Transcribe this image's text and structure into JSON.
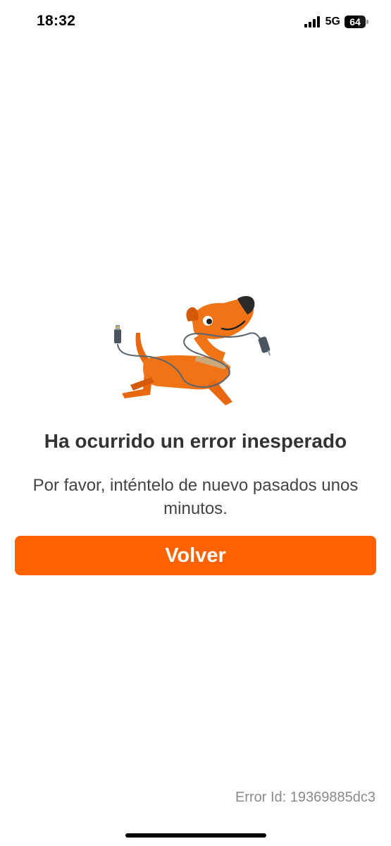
{
  "status_bar": {
    "time": "18:32",
    "network": "5G",
    "battery_percent": "64",
    "icons": [
      "signal-icon",
      "battery-icon"
    ]
  },
  "illustration": {
    "icon": "dog-with-cable-illustration"
  },
  "error": {
    "title": "Ha ocurrido un error inesperado",
    "message": "Por favor, inténtelo de nuevo pasados unos minutos.",
    "button_label": "Volver",
    "id_text": "Error Id: 19369885dc3"
  },
  "colors": {
    "accent": "#ff6200",
    "title": "#333333",
    "muted": "#8a8a8a"
  }
}
